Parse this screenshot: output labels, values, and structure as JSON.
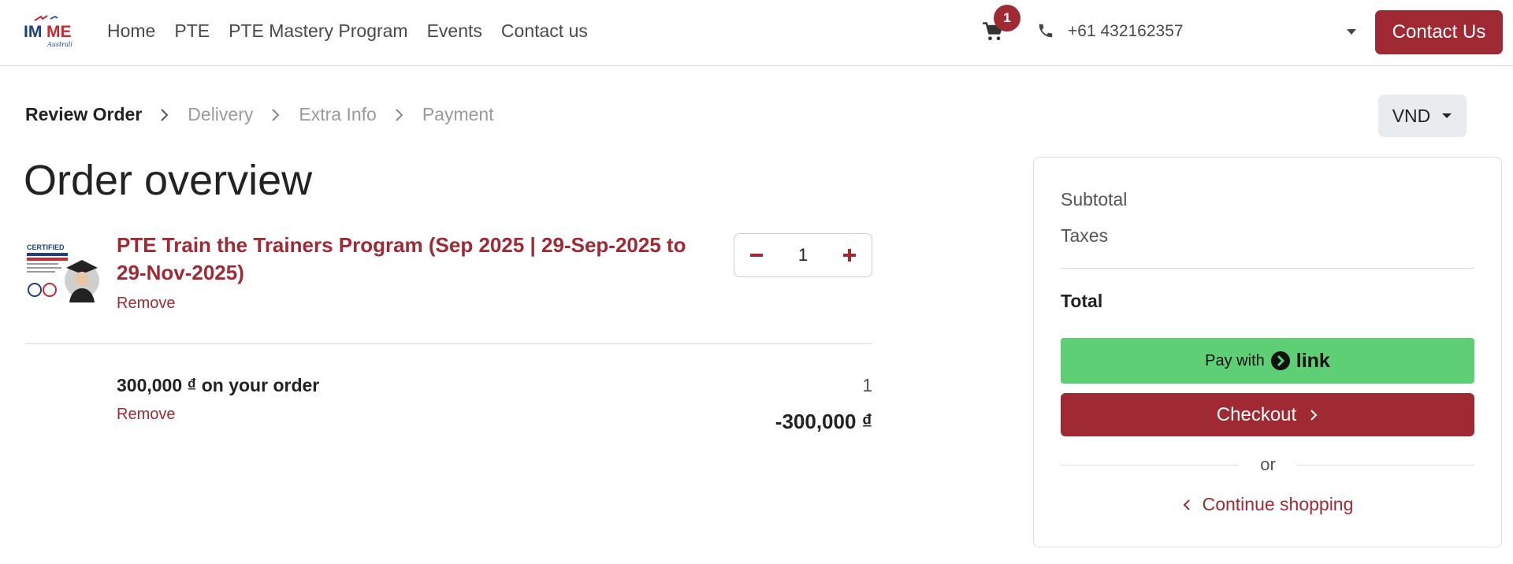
{
  "header": {
    "logo_text": "IMME",
    "logo_subtext": "Australia",
    "nav": [
      "Home",
      "PTE",
      "PTE Mastery Program",
      "Events",
      "Contact us"
    ],
    "cart_count": "1",
    "phone": "+61 432162357",
    "contact_button": "Contact Us"
  },
  "steps": [
    "Review Order",
    "Delivery",
    "Extra Info",
    "Payment"
  ],
  "currency": "VND",
  "page_title": "Order overview",
  "product": {
    "name": "PTE Train the Trainers Program (Sep 2025 | 29-Sep-2025 to 29-Nov-2025)",
    "remove_label": "Remove",
    "quantity": "1",
    "thumb_title": "CERTIFIED"
  },
  "discount": {
    "name": "300,000 ₫ on your order",
    "remove_label": "Remove",
    "quantity": "1",
    "amount": "-300,000 ₫"
  },
  "summary": {
    "subtotal_label": "Subtotal",
    "taxes_label": "Taxes",
    "total_label": "Total",
    "pay_with_label": "Pay with",
    "link_label": "link",
    "checkout_label": "Checkout",
    "or_label": "or",
    "continue_label": "Continue shopping"
  },
  "colors": {
    "brand": "#9f2a33",
    "link_green": "#5fcf75",
    "currency_bg": "#e9ecef"
  },
  "icons": {
    "cart": "cart-icon",
    "phone": "phone-icon",
    "caret": "caret-down-icon",
    "step_separator": "chevron-right-icon",
    "minus": "minus-icon",
    "plus": "plus-icon",
    "checkout_arrow": "chevron-right-icon",
    "continue_arrow": "chevron-left-icon"
  }
}
